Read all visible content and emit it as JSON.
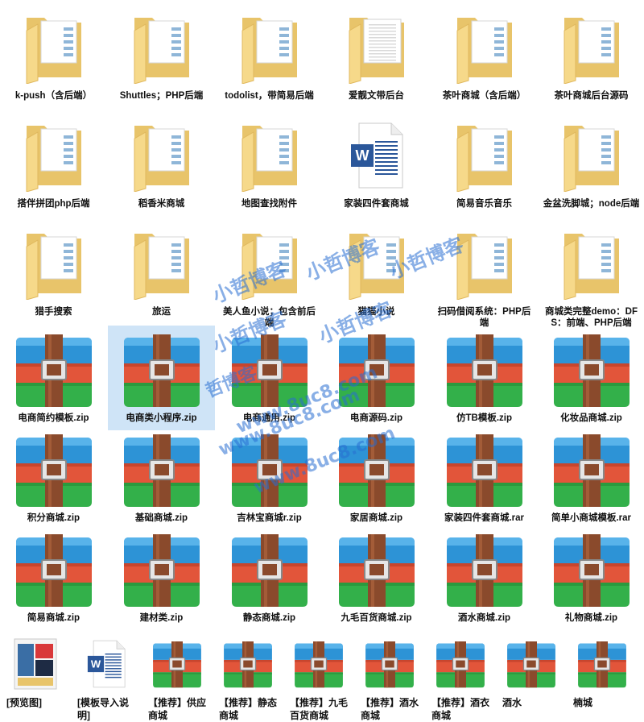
{
  "rows": [
    [
      {
        "label": "k-push（含后端）",
        "icon": "folder-doc-icon"
      },
      {
        "label": "Shuttles；PHP后端",
        "icon": "folder-doc-icon"
      },
      {
        "label": "todolist，带简易后端",
        "icon": "folder-doc-icon"
      },
      {
        "label": "爱靓文带后台",
        "icon": "folder-icon"
      },
      {
        "label": "茶叶商城（含后端）",
        "icon": "folder-doc-icon"
      },
      {
        "label": "茶叶商城后台源码",
        "icon": "folder-doc-icon"
      }
    ],
    [
      {
        "label": "搭伴拼团php后端",
        "icon": "folder-doc-icon"
      },
      {
        "label": "稻香米商城",
        "icon": "folder-doc-icon"
      },
      {
        "label": "地图查找附件",
        "icon": "folder-doc-icon"
      },
      {
        "label": "家装四件套商城",
        "icon": "word-doc-icon"
      },
      {
        "label": "简易音乐音乐",
        "icon": "folder-doc-icon"
      },
      {
        "label": "金盆洗脚城；node后端",
        "icon": "folder-doc-icon"
      }
    ],
    [
      {
        "label": "猎手搜索",
        "icon": "folder-doc-icon"
      },
      {
        "label": "旅运",
        "icon": "folder-doc-icon"
      },
      {
        "label": "美人鱼小说；包含前后端",
        "icon": "folder-doc-icon"
      },
      {
        "label": "猫猫小说",
        "icon": "folder-doc-icon"
      },
      {
        "label": "扫码借阅系统：PHP后端",
        "icon": "folder-doc-icon"
      },
      {
        "label": "商城类完整demo：DFS：前端、PHP后端",
        "icon": "folder-doc-icon"
      }
    ],
    [
      {
        "label": "电商简约模板.zip",
        "icon": "winrar-archive-icon"
      },
      {
        "label": "电商类小程序.zip",
        "icon": "winrar-archive-icon",
        "selected": true
      },
      {
        "label": "电商通用.zip",
        "icon": "winrar-archive-icon"
      },
      {
        "label": "电商源码.zip",
        "icon": "winrar-archive-icon"
      },
      {
        "label": "仿TB模板.zip",
        "icon": "winrar-archive-icon"
      },
      {
        "label": "化妆品商城.zip",
        "icon": "winrar-archive-icon"
      }
    ],
    [
      {
        "label": "积分商城.zip",
        "icon": "winrar-archive-icon"
      },
      {
        "label": "基础商城.zip",
        "icon": "winrar-archive-icon"
      },
      {
        "label": "吉林宝商城r.zip",
        "icon": "winrar-archive-icon"
      },
      {
        "label": "家居商城.zip",
        "icon": "winrar-archive-icon"
      },
      {
        "label": "家装四件套商城.rar",
        "icon": "winrar-archive-icon"
      },
      {
        "label": "简单小商城模板.rar",
        "icon": "winrar-archive-icon"
      }
    ],
    [
      {
        "label": "简易商城.zip",
        "icon": "winrar-archive-icon"
      },
      {
        "label": "建材类.zip",
        "icon": "winrar-archive-icon"
      },
      {
        "label": "静态商城.zip",
        "icon": "winrar-archive-icon"
      },
      {
        "label": "九毛百货商城.zip",
        "icon": "winrar-archive-icon"
      },
      {
        "label": "酒水商城.zip",
        "icon": "winrar-archive-icon"
      },
      {
        "label": "礼物商城.zip",
        "icon": "winrar-archive-icon"
      }
    ]
  ],
  "bottom_row": [
    {
      "label": "[预览图]",
      "icon": "preview-image-icon"
    },
    {
      "label": "[模板导入说明]",
      "icon": "word-doc-icon"
    },
    {
      "label": "【推荐】供应商城",
      "icon": "winrar-archive-icon"
    },
    {
      "label": "【推荐】静态商城",
      "icon": "winrar-archive-icon"
    },
    {
      "label": "【推荐】九毛百货商城",
      "icon": "winrar-archive-icon"
    },
    {
      "label": "【推荐】酒水商城",
      "icon": "winrar-archive-icon"
    },
    {
      "label": "【推荐】酒衣商城",
      "icon": "winrar-archive-icon"
    },
    {
      "label": "酒水",
      "icon": "winrar-archive-icon"
    },
    {
      "label": "楠城",
      "icon": "winrar-archive-icon"
    }
  ],
  "watermarks": [
    "小哲博客",
    "小哲博客",
    "小哲博客",
    "小哲博客",
    "小哲博客",
    "哲博客",
    "www.8uc8.com",
    "www.8uc8.com",
    "www.8uc8.com"
  ]
}
